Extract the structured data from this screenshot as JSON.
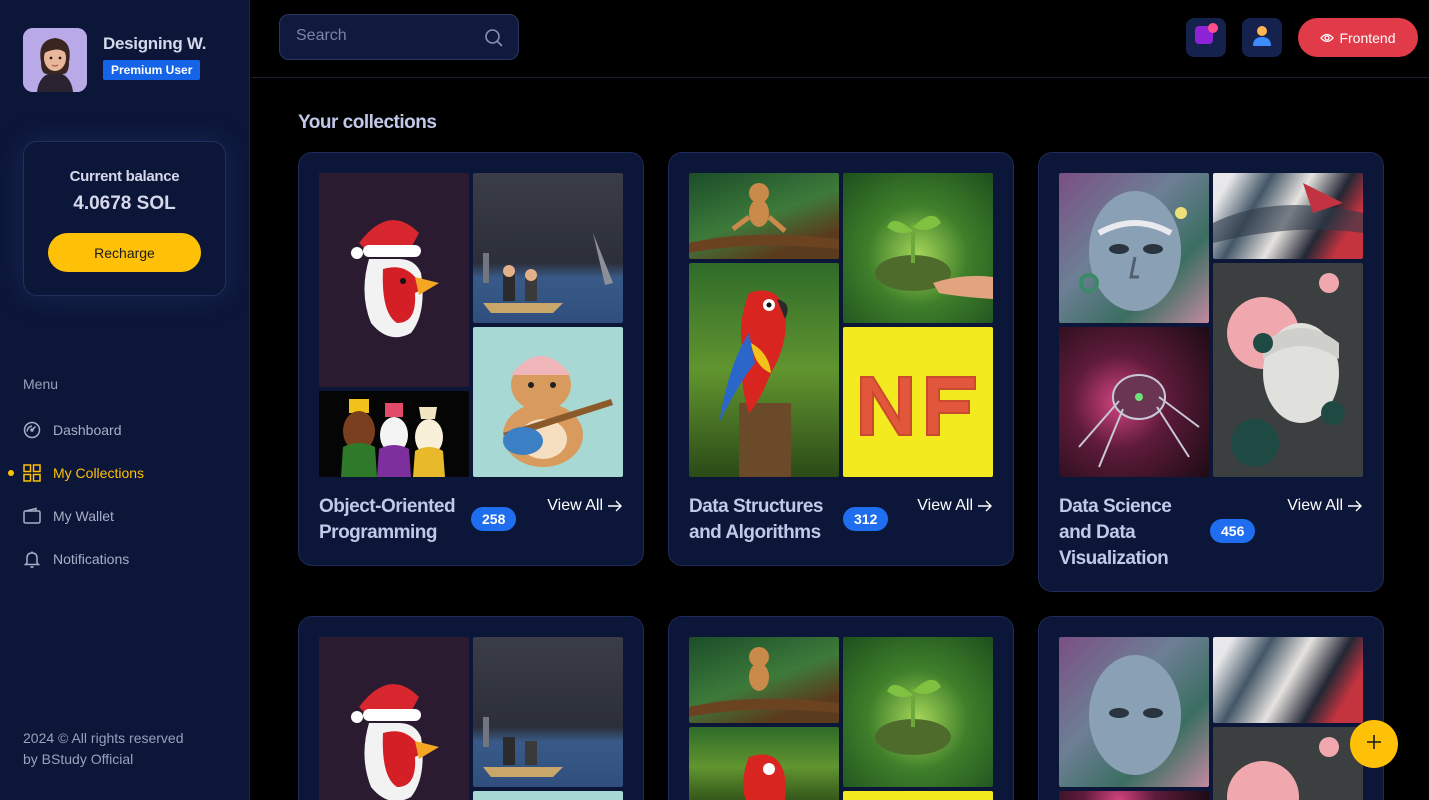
{
  "user": {
    "name": "Designing W.",
    "badge": "Premium User"
  },
  "balance": {
    "label": "Current balance",
    "value": "4.0678  SOL",
    "button": "Recharge"
  },
  "menu": {
    "title": "Menu",
    "items": [
      {
        "label": "Dashboard",
        "icon": "dashboard-icon",
        "active": false
      },
      {
        "label": "My Collections",
        "icon": "grid-icon",
        "active": true
      },
      {
        "label": "My Wallet",
        "icon": "wallet-icon",
        "active": false
      },
      {
        "label": "Notifications",
        "icon": "bell-icon",
        "active": false
      }
    ]
  },
  "footer": {
    "line1": "2024 © All rights reserved",
    "line2": "by BStudy Official"
  },
  "topbar": {
    "search_placeholder": "Search",
    "frontend_label": "Frontend"
  },
  "main": {
    "section_title": "Your collections",
    "view_all_label": "View All",
    "collections": [
      {
        "title_line1": "Object-Oriented",
        "title_line2": "Programming",
        "title_line3": "",
        "count": "258",
        "theme": "art"
      },
      {
        "title_line1": "Data Structures",
        "title_line2": "and Algorithms",
        "title_line3": "",
        "count": "312",
        "theme": "nature"
      },
      {
        "title_line1": "Data Science",
        "title_line2": "and Data",
        "title_line3": "Visualization",
        "count": "456",
        "theme": "cyber"
      },
      {
        "title_line1": "",
        "title_line2": "",
        "title_line3": "",
        "count": "",
        "theme": "art"
      },
      {
        "title_line1": "",
        "title_line2": "",
        "title_line3": "",
        "count": "",
        "theme": "nature"
      },
      {
        "title_line1": "",
        "title_line2": "",
        "title_line3": "",
        "count": "",
        "theme": "cyber"
      }
    ]
  },
  "colors": {
    "accent": "#ffc107",
    "primary_badge": "#1f6ef0",
    "frontend_button": "#e13a48",
    "sidebar_bg": "#0c1638"
  }
}
